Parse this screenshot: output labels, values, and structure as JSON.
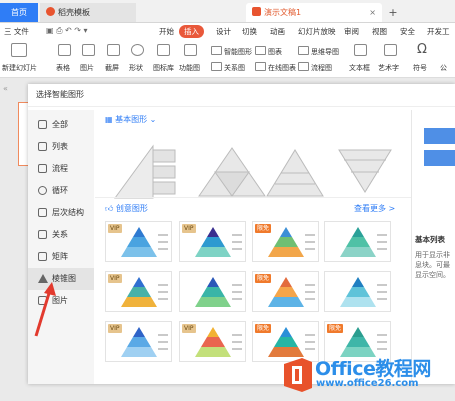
{
  "tabs": {
    "home": "首页",
    "template": "稻壳模板",
    "doc": "演示文稿1",
    "plus": "+",
    "close": "×"
  },
  "menu": [
    "三 文件",
    "开始",
    "插入",
    "设计",
    "切换",
    "动画",
    "幻灯片放映",
    "审阅",
    "视图",
    "安全",
    "开发工"
  ],
  "toolbar": {
    "new_slide": "新建幻灯片",
    "table": "表格",
    "picture": "图片",
    "screenshot": "截屏",
    "shape": "形状",
    "icon_lib": "图标库",
    "func_chart": "功能图",
    "smart_shape": "智能图形",
    "chart": "图表",
    "mindmap": "思维导图",
    "relation": "关系图",
    "online_chart": "在线图表",
    "flowchart": "流程图",
    "textbox": "文本框",
    "art_text": "艺术字",
    "symbol": "符号",
    "formula": "公"
  },
  "dialog": {
    "title": "选择智能图形",
    "categories": [
      {
        "label": "全部",
        "icon": "grid-icon"
      },
      {
        "label": "列表",
        "icon": "list-icon"
      },
      {
        "label": "流程",
        "icon": "flow-icon"
      },
      {
        "label": "循环",
        "icon": "cycle-icon"
      },
      {
        "label": "层次结构",
        "icon": "hierarchy-icon"
      },
      {
        "label": "关系",
        "icon": "relation-icon"
      },
      {
        "label": "矩阵",
        "icon": "matrix-icon"
      },
      {
        "label": "棱锥图",
        "icon": "pyramid-icon"
      },
      {
        "label": "图片",
        "icon": "picture-icon"
      }
    ],
    "selected_category": "棱锥图",
    "basic_section": "基本图形",
    "creative_section": "创意图形",
    "view_more": "查看更多 >",
    "vip_badge": "VIP",
    "free_badge": "限免",
    "card_badges": [
      "VIP",
      "VIP",
      "限免",
      "",
      "VIP",
      "",
      "限免",
      "",
      "VIP",
      "VIP",
      "限免",
      "限免"
    ],
    "right_panel_title": "基本列表",
    "right_panel_desc": [
      "用于显示非",
      "息块。可最",
      "显示空间。"
    ]
  },
  "watermark": {
    "brand": "Office教程网",
    "url": "www.office26.com"
  },
  "colors": {
    "accent_blue": "#2f7df6",
    "insert_tab": "#e9583a",
    "vip_gold": "#e6c48d",
    "free_orange": "#f07a2c",
    "watermark_blue": "#2c8ee9"
  }
}
